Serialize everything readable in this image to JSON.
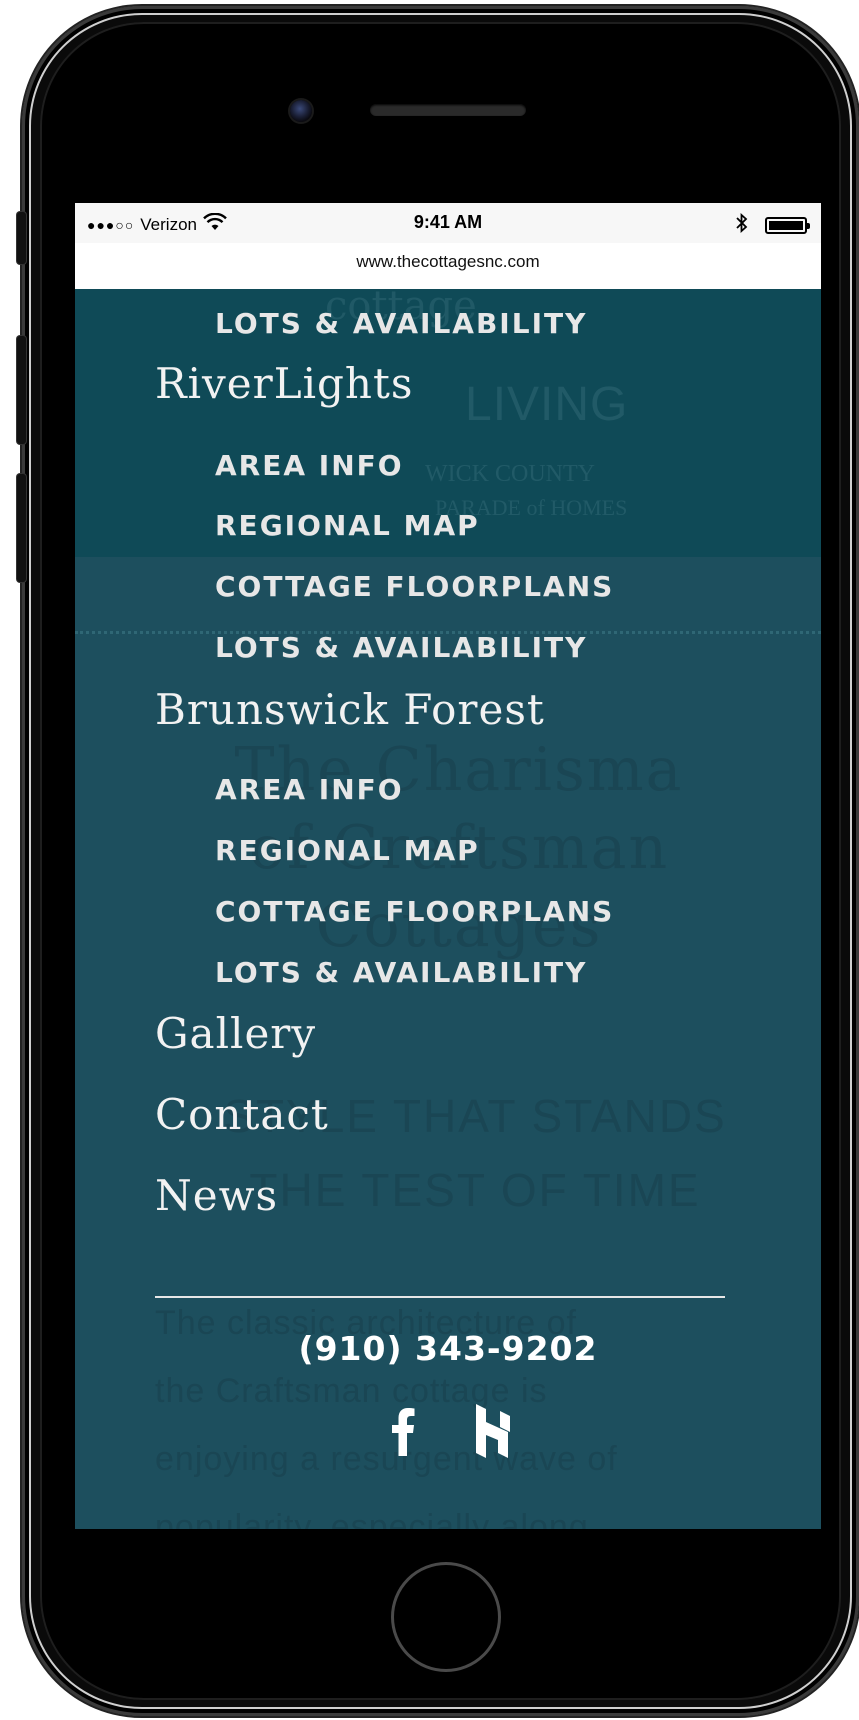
{
  "status_bar": {
    "signal": "●●●○○",
    "carrier": "Verizon",
    "wifi_icon": "wifi-icon",
    "time": "9:41 AM",
    "bluetooth_icon": "bluetooth-icon",
    "battery_icon": "battery-icon"
  },
  "browser": {
    "url": "www.thecottagesnc.com"
  },
  "background_page": {
    "hero_logo": "cottage",
    "hero_living": "LIVING",
    "hero_county": "WICK COUNTY",
    "hero_parade": "PARADE of HOMES",
    "heading_lines": [
      "The Charisma",
      "of Craftsman",
      "Cottages"
    ],
    "subheading_lines": [
      "STYLE THAT STANDS",
      "THE TEST OF TIME"
    ],
    "paragraph_lines": [
      "The classic architecture of",
      "the Craftsman cottage is",
      "enjoying a resurgent wave of",
      "popularity, especially along"
    ]
  },
  "menu": {
    "top_sub_item": "LOTS & AVAILABILITY",
    "sections": [
      {
        "label": "RiverLights",
        "items": [
          "AREA INFO",
          "REGIONAL MAP",
          "COTTAGE FLOORPLANS",
          "LOTS & AVAILABILITY"
        ]
      },
      {
        "label": "Brunswick Forest",
        "items": [
          "AREA INFO",
          "REGIONAL MAP",
          "COTTAGE FLOORPLANS",
          "LOTS & AVAILABILITY"
        ]
      }
    ],
    "links": [
      "Gallery",
      "Contact",
      "News"
    ],
    "phone": "(910) 343-9202",
    "social": [
      "facebook-icon",
      "houzz-icon"
    ]
  },
  "colors": {
    "menu_background": "#1d4f5e",
    "hero_background": "#0f4a57",
    "menu_text": "#f2f2f2"
  }
}
